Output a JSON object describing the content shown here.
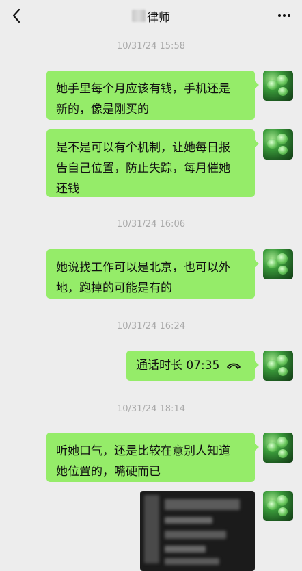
{
  "header": {
    "title": "律师",
    "back_icon": "chevron-left-icon",
    "more_icon": "more-dots-icon"
  },
  "colors": {
    "background": "#ededed",
    "bubble_outgoing": "#95ec69",
    "timestamp_text": "#a9a9a9"
  },
  "messages": [
    {
      "timestamp": "10/31/24 15:58"
    },
    {
      "text": "她手里每个月应该有钱，手机还是\n新的，像是刚买的"
    },
    {
      "text": "是不是可以有个机制，让她每日报\n告自己位置，防止失踪，每月催她\n还钱"
    },
    {
      "timestamp": "10/31/24 16:06"
    },
    {
      "text": "她说找工作可以是北京，也可以外\n地，跑掉的可能是有的"
    },
    {
      "timestamp": "10/31/24 16:24"
    },
    {
      "call_label": "通话时长 07:35",
      "call_icon": "phone-hangup-icon"
    },
    {
      "timestamp": "10/31/24 18:14"
    },
    {
      "text": "听她口气，还是比较在意别人知道\n她位置的，嘴硬而已"
    },
    {
      "image": "blurred-screenshot"
    }
  ]
}
